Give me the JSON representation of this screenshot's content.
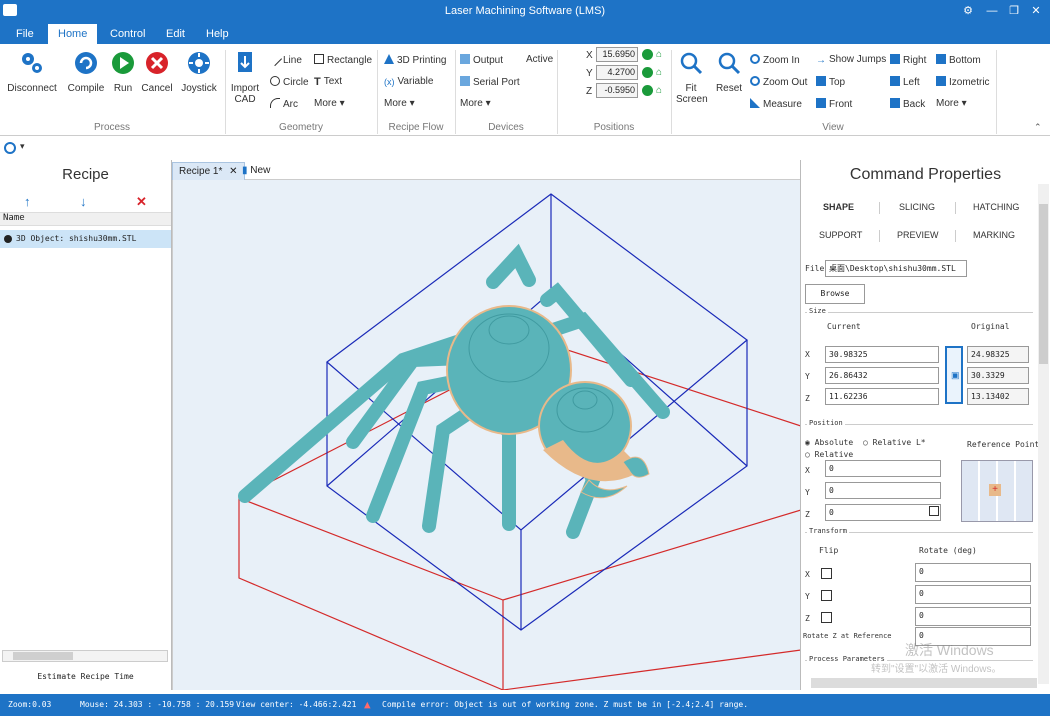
{
  "window": {
    "title": "Laser Machining Software (LMS)"
  },
  "menu": {
    "tabs": [
      "File",
      "Home",
      "Control",
      "Edit",
      "Help"
    ]
  },
  "ribbon": {
    "process": {
      "label": "Process",
      "buttons": [
        "Disconnect",
        "Compile",
        "Run",
        "Cancel",
        "Joystick"
      ]
    },
    "geometry": {
      "label": "Geometry",
      "import": "Import CAD",
      "line": "Line",
      "circle": "Circle",
      "arc": "Arc",
      "rectangle": "Rectangle",
      "text": "Text",
      "more": "More"
    },
    "recipe_flow": {
      "label": "Recipe Flow",
      "printing": "3D Printing",
      "variable": "Variable",
      "more": "More"
    },
    "devices": {
      "label": "Devices",
      "output": "Output",
      "active": "Active",
      "serial": "Serial Port",
      "more": "More"
    },
    "positions": {
      "label": "Positions",
      "x_label": "X",
      "y_label": "Y",
      "z_label": "Z",
      "x": "15.6950",
      "y": "4.2700",
      "z": "-0.5950"
    },
    "view": {
      "label": "View",
      "fit": "Fit Screen",
      "reset": "Reset",
      "zoom_in": "Zoom In",
      "zoom_out": "Zoom Out",
      "measure": "Measure",
      "show_jumps": "Show Jumps",
      "top": "Top",
      "front": "Front",
      "right": "Right",
      "left": "Left",
      "back": "Back",
      "bottom": "Bottom",
      "isometric": "Izometric",
      "more": "More"
    }
  },
  "recipe_panel": {
    "title": "Recipe",
    "column_header": "Name",
    "item": "3D Object: shishu30mm.STL",
    "estimate": "Estimate Recipe Time"
  },
  "doc_tabs": {
    "active": "Recipe 1*",
    "new": "New"
  },
  "properties": {
    "title": "Command Properties",
    "tabs": [
      "SHAPE",
      "SLICING",
      "HATCHING",
      "SUPPORT",
      "PREVIEW",
      "MARKING"
    ],
    "file_label": "File",
    "file_value": "桌面\\Desktop\\shishu30mm.STL",
    "browse": "Browse",
    "size": {
      "section": "Size",
      "current_header": "Current",
      "original_header": "Original",
      "x_label": "X",
      "y_label": "Y",
      "z_label": "Z",
      "current_x": "30.98325",
      "current_y": "26.86432",
      "current_z": "11.62236",
      "original_x": "24.98325",
      "original_y": "30.3329",
      "original_z": "13.13402"
    },
    "position": {
      "section": "Position",
      "absolute": "Absolute",
      "relative": "Relative L*",
      "relative2": "Relative",
      "reference_point": "Reference Point",
      "x_label": "X",
      "y_label": "Y",
      "z_label": "Z",
      "x": "0",
      "y": "0",
      "z": "0"
    },
    "transform": {
      "section": "Transform",
      "flip": "Flip",
      "rotate": "Rotate (deg)",
      "x_label": "X",
      "y_label": "Y",
      "z_label": "Z",
      "rx": "0",
      "ry": "0",
      "rz": "0",
      "rotate_ref_label": "Rotate Z at Reference",
      "rotate_ref": "0"
    },
    "process_params": "Process Parameters"
  },
  "watermark": {
    "line1": "激活 Windows",
    "line2": "转到\"设置\"以激活 Windows。"
  },
  "status": {
    "zoom": "Zoom:0.03",
    "mouse": "Mouse: 24.303 : -10.758 : 20.159",
    "view_center": "View center: -4.466:2.421",
    "error": "Compile error: Object is out of working zone. Z must be in [-2.4;2.4] range."
  },
  "colors": {
    "accent": "#1e73c6",
    "model": "#5ab4b9",
    "model_edge": "#e8b98a",
    "box_blue": "#1a2ab8",
    "box_red": "#d42a2a"
  }
}
